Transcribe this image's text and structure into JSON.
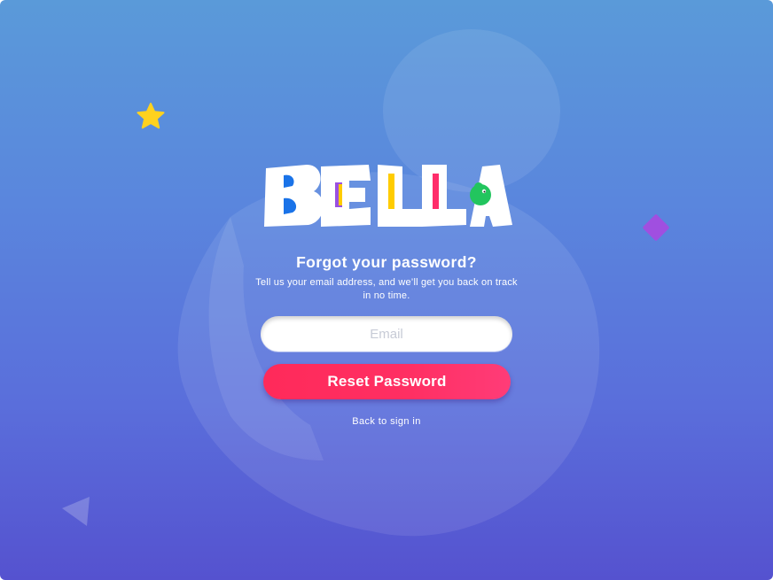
{
  "app": {
    "logo_text": "BELLA"
  },
  "forgot": {
    "title": "Forgot your password?",
    "subtitle": "Tell us your email address, and we’ll get you back on track in no time.",
    "email_placeholder": "Email",
    "email_value": "",
    "reset_label": "Reset Password",
    "back_label": "Back to sign in"
  },
  "colors": {
    "background_top": "#5a9ad9",
    "background_bottom": "#5552cf",
    "primary_button": "#ff2f63",
    "star": "#ffd21f",
    "diamond": "#a04fe0",
    "logo_blue": "#1a73e8",
    "logo_purple": "#9b51e0",
    "logo_yellow": "#ffcc00",
    "logo_pink": "#ff2d6a",
    "logo_green": "#22c55e"
  },
  "icons": {
    "star": "star-icon",
    "diamond": "diamond-icon",
    "triangle": "triangle-icon",
    "mascot": "mascot-silhouette"
  }
}
